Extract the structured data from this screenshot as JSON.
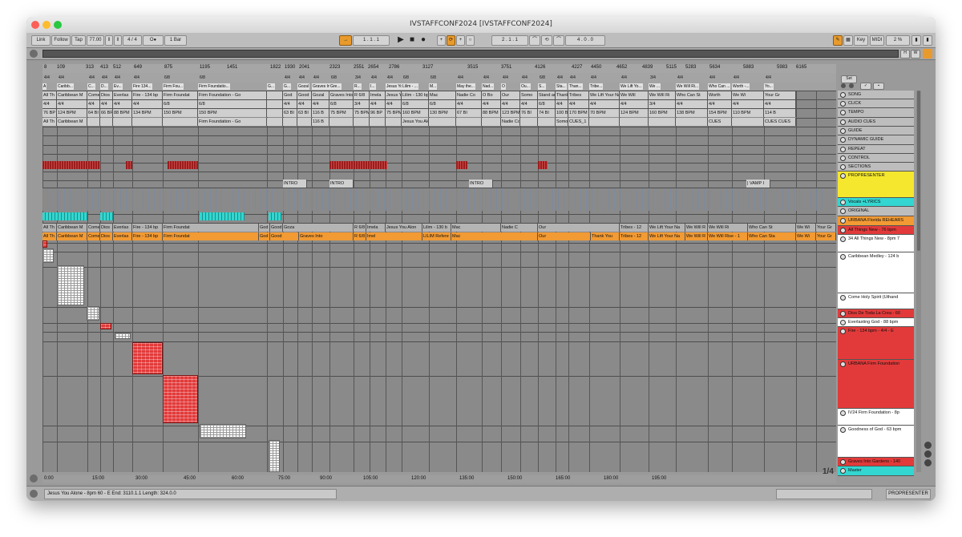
{
  "window": {
    "title": "IVSTAFFCONF2024  [IVSTAFFCONF2024]"
  },
  "controlbar": {
    "link": "Link",
    "follow": "Follow",
    "tap": "Tap",
    "tempo": "77.00",
    "signature": "4 / 4",
    "metronome": "O●",
    "quantize": "1 Bar",
    "position": "1 .  1 .  1",
    "loop_start": "2 .  1 .  1",
    "loop_length": "4 .  0 .  0",
    "key": "Key",
    "midi": "MIDI",
    "cpu": "2 %"
  },
  "ruler": [
    "8",
    "109",
    "313",
    "413",
    "512",
    "649",
    "875",
    "1195",
    "1451",
    "1822",
    "1930",
    "2041",
    "2323",
    "2551",
    "2654",
    "2786",
    "3127",
    "3515",
    "3751",
    "4126",
    "4227",
    "4450",
    "4652",
    "4839",
    "5115",
    "5283",
    "5634",
    "5883",
    "5983",
    "6165"
  ],
  "meta_rows": [
    [
      "All Th",
      "Caribbean M",
      "Come",
      "Dios",
      "Everlas",
      "Fire - 134 bp",
      "Firm Foundat",
      "Firm Foundation - Go",
      "",
      "God",
      "Good",
      "Gozal",
      "Graves Into",
      "R 6/8",
      "Imela",
      "Jesus You Alon",
      "Lilim - 130 bp",
      "Mac",
      "Nadie Co",
      "O Bo",
      "Our",
      "Somo",
      "Stand an",
      "Thank You",
      "Tribes",
      "We Lift Your Na",
      "We Will",
      "We Will Ri",
      "Who Can St",
      "Worth",
      "We Wi",
      "Your Gr"
    ],
    [
      "4/4",
      "4/4",
      "4/4",
      "4/4",
      "4/4",
      "4/4",
      "6/8",
      "6/8",
      "",
      "4/4",
      "4/4",
      "4/4",
      "6/8",
      "3/4",
      "4/4",
      "4/4",
      "6/8",
      "6/8",
      "4/4",
      "4/4",
      "4/4",
      "4/4",
      "6/8",
      "4/4",
      "4/4",
      "4/4",
      "4/4",
      "3/4",
      "4/4",
      "4/4",
      "4/4",
      "4/4"
    ],
    [
      "76 BP",
      "124 BPM",
      "64 BI",
      "66 BP",
      "88 BPM",
      "134 BPM",
      "150 BPM",
      "150 BPM",
      "",
      "63 BI",
      "63 BI",
      "116 B",
      "75 BPM",
      "75 BPM",
      "96 BP",
      "75 BPM",
      "160 BPM",
      "130 BPM",
      "67 BI",
      "88 BPM",
      "123 BPM",
      "76 BI",
      "74 BI",
      "100 B",
      "170 BPM",
      "70 BPM",
      "124 BPM",
      "160 BPM",
      "138 BPM",
      "154 BPM",
      "110 BPM",
      "114 B"
    ],
    [
      "All Th",
      "Caribbean M",
      "",
      "",
      "",
      "",
      "",
      "Firm Foundation - Go",
      "",
      "",
      "",
      "116 B",
      "",
      "",
      "",
      "",
      "Jesus You Alon",
      "",
      "",
      "",
      "Nadie Co",
      "",
      "",
      "Somo",
      "CUES_1",
      "",
      "",
      "",
      "",
      "CUES",
      "",
      "CUES CUES"
    ]
  ],
  "locators": [
    "A",
    "Caribb...",
    "C...",
    "D...",
    "Ev...",
    "Fire 134...",
    "Firm Fou...",
    "Firm Foundatio...",
    "G...",
    "G...",
    "Gozal",
    "Graves Into",
    "Gre...",
    "R...",
    "I...",
    "Jesus You...",
    "Lilim - ...",
    "M...",
    "May the...",
    "Nad...",
    "O",
    "Ou...",
    "S...",
    "Sta...",
    "Than...",
    "Tribe...",
    "We Lift Yo...",
    "We ...",
    "We Will Ri...",
    "Who Can ...",
    "Worth -...",
    "Yo..."
  ],
  "section_labels": [
    "INTRO",
    "INTRO",
    "INTRO",
    "| VAMP I"
  ],
  "vocal_clips": [
    "All Th",
    "Caribbean M",
    "Come",
    "Dios",
    "Everlas",
    "Fire - 134 bp",
    "Firm Foundat",
    "God",
    "Good",
    "Goza",
    "R 6/8",
    "Imela",
    "Jesus You Alon",
    "Lilim - 130 b",
    "Mac",
    "Nadie C",
    "Our",
    "Tribes - 12",
    "We Lift Your Na",
    "We Will R",
    "We Will Ri",
    "Who Can St",
    "We Wi",
    "Your Gr"
  ],
  "original_clips": [
    "All Th",
    "Caribbean M",
    "Come",
    "Dios",
    "Everlas",
    "Fire - 134 bp",
    "Firm Foundat",
    "God",
    "Good",
    "Graves Into",
    "R 6/8",
    "Imel",
    "LILIM Refere",
    "Mac",
    "Our",
    "Thank You",
    "Tribes - 12",
    "We Lift Your Na",
    "We Will R",
    "We Will Rise - 1",
    "Who Can Sta",
    "We Wi",
    "Your Gr"
  ],
  "tracks": [
    {
      "name": "SONG",
      "color": "#bdbdbd"
    },
    {
      "name": "CLICK",
      "color": "#bdbdbd"
    },
    {
      "name": "TEMPO",
      "color": "#bdbdbd"
    },
    {
      "name": "AUDIO CUES",
      "color": "#bdbdbd"
    },
    {
      "name": "GUIDE",
      "color": "#bdbdbd"
    },
    {
      "name": "DYNAMIC GUIDE",
      "color": "#bdbdbd"
    },
    {
      "name": "REPEAT",
      "color": "#bdbdbd"
    },
    {
      "name": "CONTROL",
      "color": "#bdbdbd"
    },
    {
      "name": "SECTIONS",
      "color": "#bdbdbd"
    },
    {
      "name": "PROPRESENTER",
      "color": "#f5e72d"
    },
    {
      "name": "Vocals +LYRICS",
      "color": "#33d6d0"
    },
    {
      "name": "ORIGINAL",
      "color": "#bdbdbd"
    },
    {
      "name": "URBANA Florida REHEARS",
      "color": "#f29a33"
    },
    {
      "name": "All Things New - 76 bpm",
      "color": "#e23a3a"
    },
    {
      "name": "34 All Things New - 8pm 7",
      "color": "#ffffff"
    },
    {
      "name": "Caribbean Medley - 124 b",
      "color": "#ffffff"
    },
    {
      "name": "Come Holy Spirit (Uthand",
      "color": "#ffffff"
    },
    {
      "name": "Dios De Toda La Crea - 66",
      "color": "#e23a3a"
    },
    {
      "name": "Everlasting God - 88 bpm",
      "color": "#ffffff"
    },
    {
      "name": "Fire - 134 bpm - 4/4 - E",
      "color": "#e23a3a"
    },
    {
      "name": "URBANA Firm Foundation",
      "color": "#e23a3a"
    },
    {
      "name": "IV24 Firm Foundation - 8p",
      "color": "#ffffff"
    },
    {
      "name": "Goodness of God - 63 bpm",
      "color": "#ffffff"
    },
    {
      "name": "Graves Into Gardens - 140",
      "color": "#e23a3a"
    },
    {
      "name": "Master",
      "color": "#33d6d0"
    }
  ],
  "set_label": "Set",
  "timeline": [
    "0:00",
    "15:00",
    "30:00",
    "45:00",
    "60:00",
    "75:00",
    "90:00",
    "105:00",
    "120:00",
    "135:00",
    "150:00",
    "165:00",
    "180:00",
    "195:00"
  ],
  "zoom_label": "1/4",
  "status": {
    "selection": "Jesus You Alone - 8pm 60 - E  End: 3110.1.1  Length: 324.0.0",
    "right": "PROPRESENTER"
  }
}
